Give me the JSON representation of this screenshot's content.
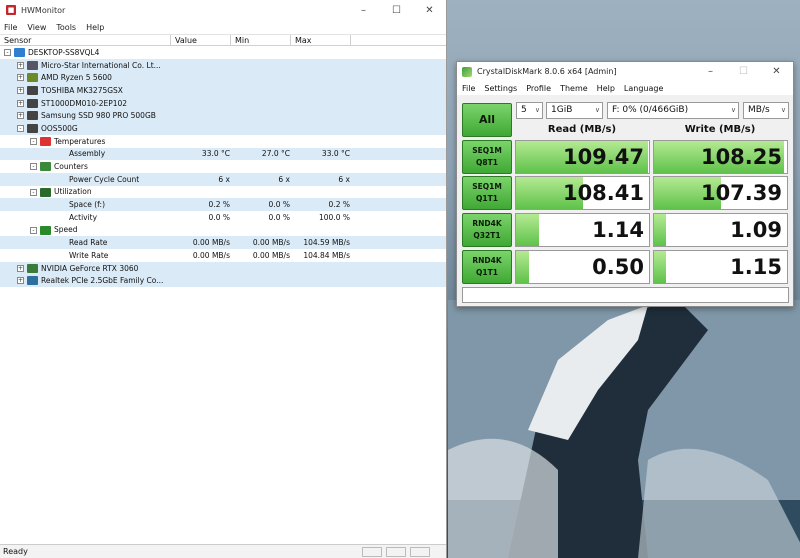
{
  "hwmonitor": {
    "title": "HWMonitor",
    "menu": [
      "File",
      "View",
      "Tools",
      "Help"
    ],
    "columns": [
      "Sensor",
      "Value",
      "Min",
      "Max"
    ],
    "status": "Ready",
    "rows": [
      {
        "label": "DESKTOP-SS8VQL4",
        "level": 0,
        "expand": "-",
        "icon": "computer-icon",
        "sel": false,
        "value": "",
        "min": "",
        "max": ""
      },
      {
        "label": "Micro-Star International Co. Lt...",
        "level": 1,
        "expand": "+",
        "icon": "motherboard-icon",
        "sel": true,
        "value": "",
        "min": "",
        "max": ""
      },
      {
        "label": "AMD Ryzen 5 5600",
        "level": 1,
        "expand": "+",
        "icon": "cpu-icon",
        "sel": true,
        "value": "",
        "min": "",
        "max": ""
      },
      {
        "label": "TOSHIBA MK3275GSX",
        "level": 1,
        "expand": "+",
        "icon": "disk-icon",
        "sel": true,
        "value": "",
        "min": "",
        "max": ""
      },
      {
        "label": "ST1000DM010-2EP102",
        "level": 1,
        "expand": "+",
        "icon": "disk-icon",
        "sel": true,
        "value": "",
        "min": "",
        "max": ""
      },
      {
        "label": "Samsung SSD 980 PRO 500GB",
        "level": 1,
        "expand": "+",
        "icon": "disk-icon",
        "sel": true,
        "value": "",
        "min": "",
        "max": ""
      },
      {
        "label": "OOS500G",
        "level": 1,
        "expand": "-",
        "icon": "disk-icon",
        "sel": true,
        "value": "",
        "min": "",
        "max": ""
      },
      {
        "label": "Temperatures",
        "level": 2,
        "expand": "-",
        "icon": "thermometer-icon",
        "sel": false,
        "value": "",
        "min": "",
        "max": ""
      },
      {
        "label": "Assembly",
        "level": 3,
        "expand": "",
        "icon": "",
        "sel": true,
        "value": "33.0 °C",
        "min": "27.0 °C",
        "max": "33.0 °C"
      },
      {
        "label": "Counters",
        "level": 2,
        "expand": "-",
        "icon": "counter-icon",
        "sel": false,
        "value": "",
        "min": "",
        "max": ""
      },
      {
        "label": "Power Cycle Count",
        "level": 3,
        "expand": "",
        "icon": "",
        "sel": true,
        "value": "6 x",
        "min": "6 x",
        "max": "6 x"
      },
      {
        "label": "Utilization",
        "level": 2,
        "expand": "-",
        "icon": "utilization-icon",
        "sel": false,
        "value": "",
        "min": "",
        "max": ""
      },
      {
        "label": "Space (f:)",
        "level": 3,
        "expand": "",
        "icon": "",
        "sel": true,
        "value": "0.2 %",
        "min": "0.0 %",
        "max": "0.2 %"
      },
      {
        "label": "Activity",
        "level": 3,
        "expand": "",
        "icon": "",
        "sel": false,
        "value": "0.0 %",
        "min": "0.0 %",
        "max": "100.0 %"
      },
      {
        "label": "Speed",
        "level": 2,
        "expand": "-",
        "icon": "speed-icon",
        "sel": false,
        "value": "",
        "min": "",
        "max": ""
      },
      {
        "label": "Read Rate",
        "level": 3,
        "expand": "",
        "icon": "",
        "sel": true,
        "value": "0.00 MB/s",
        "min": "0.00 MB/s",
        "max": "104.59 MB/s"
      },
      {
        "label": "Write Rate",
        "level": 3,
        "expand": "",
        "icon": "",
        "sel": false,
        "value": "0.00 MB/s",
        "min": "0.00 MB/s",
        "max": "104.84 MB/s"
      },
      {
        "label": "NVIDIA GeForce RTX 3060",
        "level": 1,
        "expand": "+",
        "icon": "gpu-icon",
        "sel": true,
        "value": "",
        "min": "",
        "max": ""
      },
      {
        "label": "Realtek PCIe 2.5GbE Family Co...",
        "level": 1,
        "expand": "+",
        "icon": "network-icon",
        "sel": true,
        "value": "",
        "min": "",
        "max": ""
      }
    ]
  },
  "cdm": {
    "title": "CrystalDiskMark 8.0.6 x64 [Admin]",
    "menu": [
      "File",
      "Settings",
      "Profile",
      "Theme",
      "Help",
      "Language"
    ],
    "all_label": "All",
    "count": "5",
    "size": "1GiB",
    "drive": "F: 0% (0/466GiB)",
    "unit": "MB/s",
    "read_header": "Read (MB/s)",
    "write_header": "Write (MB/s)",
    "tests": [
      {
        "l1": "SEQ1M",
        "l2": "Q8T1",
        "read": "109.47",
        "write": "108.25",
        "read_fill": 0.99,
        "write_fill": 0.98
      },
      {
        "l1": "SEQ1M",
        "l2": "Q1T1",
        "read": "108.41",
        "write": "107.39",
        "read_fill": 0.5,
        "write_fill": 0.5
      },
      {
        "l1": "RND4K",
        "l2": "Q32T1",
        "read": "1.14",
        "write": "1.09",
        "read_fill": 0.17,
        "write_fill": 0.09
      },
      {
        "l1": "RND4K",
        "l2": "Q1T1",
        "read": "0.50",
        "write": "1.15",
        "read_fill": 0.1,
        "write_fill": 0.09
      }
    ]
  }
}
